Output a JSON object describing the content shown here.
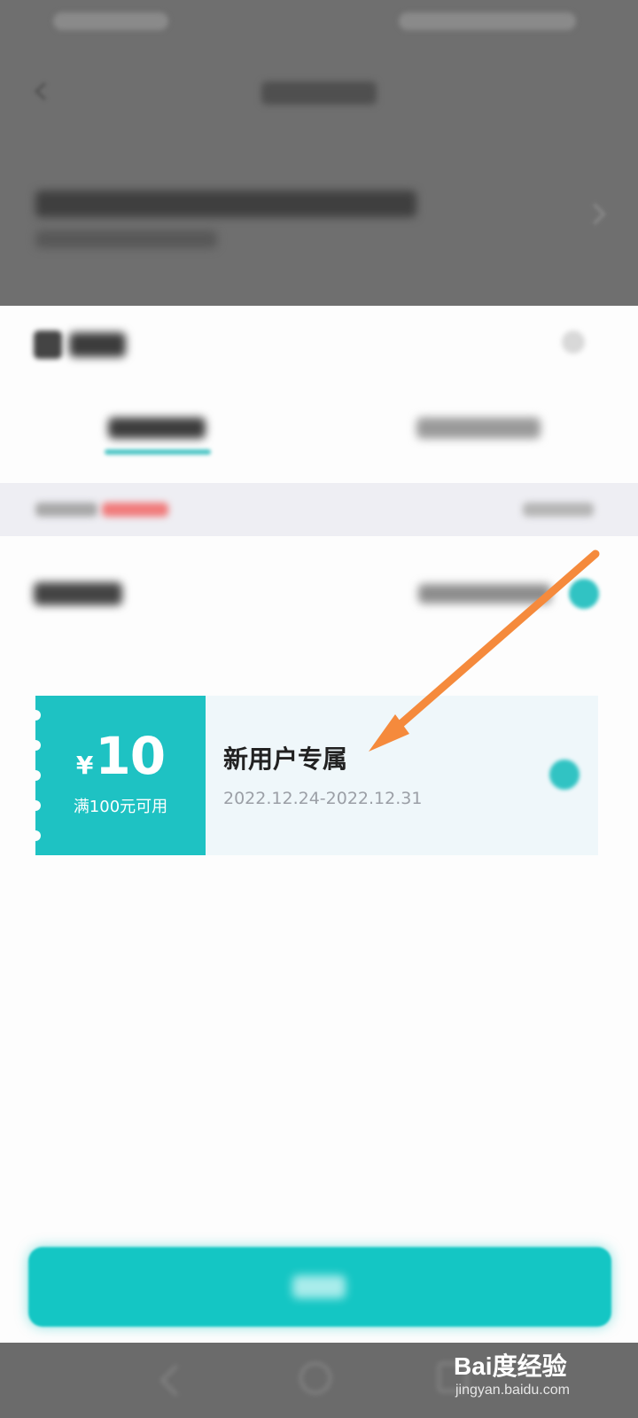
{
  "coupon": {
    "currency_symbol": "¥",
    "amount": "10",
    "condition": "满100元可用",
    "title": "新用户专属",
    "validity": "2022.12.24-2022.12.31",
    "accent_color": "#1ec2c3"
  },
  "confirm_button": {
    "color": "#14c6c4"
  },
  "annotation": {
    "arrow_color": "#f58a3c"
  },
  "watermark": {
    "logo": "Bai度经验",
    "site": "jingyan.baidu.com"
  },
  "icons": [
    "back-icon",
    "close-icon",
    "chevron-right-icon",
    "check-circle-icon",
    "coupon-icon"
  ]
}
